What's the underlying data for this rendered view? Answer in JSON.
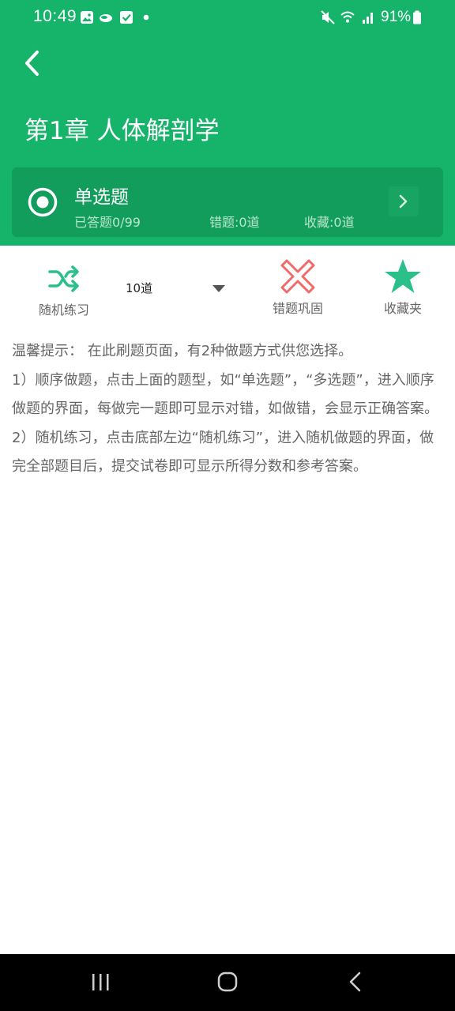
{
  "status_bar": {
    "time": "10:49",
    "battery": "91%"
  },
  "header": {
    "title": "第1章 人体解剖学"
  },
  "question_type": {
    "title": "单选题",
    "answered": "已答题0/99",
    "wrong": "错题:0道",
    "favorites": "收藏:0道"
  },
  "tools": {
    "random_label": "随机练习",
    "count_selected": "10道",
    "wrong_review_label": "错题巩固",
    "favorites_label": "收藏夹"
  },
  "tips": {
    "line1": "温馨提示： 在此刷题页面，有2种做题方式供您选择。",
    "line2": " 1）顺序做题，点击上面的题型，如“单选题”，“多选题”，进入顺序做题的界面，每做完一题即可显示对错，如做错，会显示正确答案。",
    "line3": " 2）随机练习，点击底部左边“随机练习”，进入随机做题的界面，做完全部题目后，提交试卷即可显示所得分数和参考答案。"
  },
  "colors": {
    "primary_green": "#16b46a",
    "card_green": "#139d5c",
    "accent_teal": "#2bbf8a",
    "wrong_red": "#f06a6a"
  }
}
